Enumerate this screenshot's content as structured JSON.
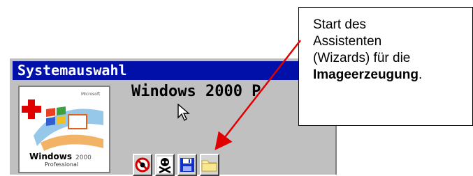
{
  "window": {
    "title": "Systemauswahl",
    "os_name": "Windows 2000 P",
    "logo": {
      "microsoft_label": "Microsoft",
      "windows_label": "Windows",
      "version_label": "2000",
      "edition_label": "Professional"
    },
    "toolbar": {
      "buttons": [
        {
          "icon": "no-entry-icon"
        },
        {
          "icon": "skull-icon"
        },
        {
          "icon": "floppy-disk-icon"
        },
        {
          "icon": "folder-icon"
        }
      ]
    }
  },
  "callout": {
    "line1": "Start des",
    "line2": "Assistenten",
    "line3": "(Wizards) für die",
    "line4_bold": "Imageerzeugung",
    "line4_tail": "."
  },
  "colors": {
    "titlebar": "#0010a8",
    "arrow": "#e00000",
    "window_bg": "#c0c0c0"
  }
}
